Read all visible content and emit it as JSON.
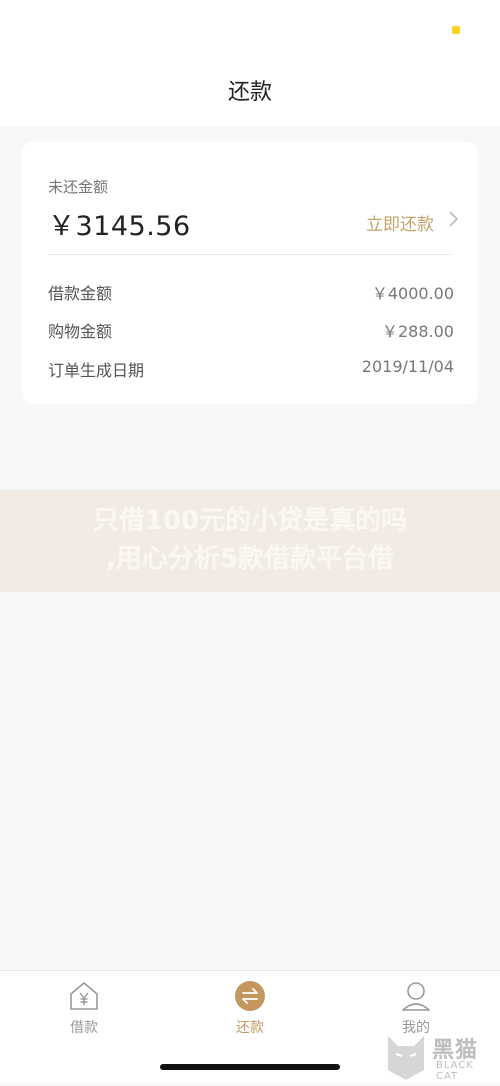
{
  "header": {
    "title": "还款"
  },
  "card": {
    "unpaid_label": "未还金额",
    "unpaid_amount": "￥3145.56",
    "repay_now_label": "立即还款",
    "rows": [
      {
        "key": "借款金额",
        "value": "￥4000.00"
      },
      {
        "key": "购物金额",
        "value": "￥288.00"
      },
      {
        "key": "订单生成日期",
        "value": "2019/11/04"
      }
    ]
  },
  "banner": {
    "lines": [
      "只借100元的小贷是真的吗",
      ",用心分析5款借款平台借"
    ]
  },
  "tabbar": {
    "items": [
      {
        "label": "借款",
        "icon": "house-yen-icon",
        "active": false
      },
      {
        "label": "还款",
        "icon": "exchange-icon",
        "active": true
      },
      {
        "label": "我的",
        "icon": "user-icon",
        "active": false
      }
    ]
  },
  "watermark": {
    "cn": "黑猫",
    "en": "BLACK CAT"
  },
  "colors": {
    "accent": "#c4975f",
    "repay_link": "#c4a36b",
    "status_dot": "#f6d21e"
  }
}
